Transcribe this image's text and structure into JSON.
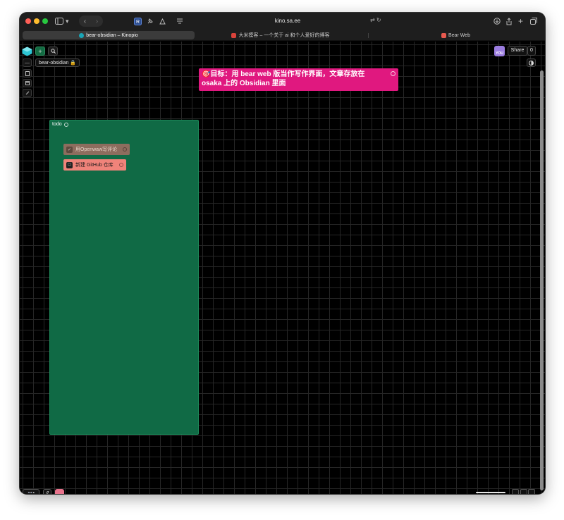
{
  "browser": {
    "url": "kino.sa.ee",
    "tabs": [
      {
        "label": "bear-obsidian – Kinopio",
        "favicon_color": "#1aa6b7",
        "active": true
      },
      {
        "label": "大米摸客 – 一个关于 ai 和个人爱好的博客",
        "favicon_color": "#d9433b",
        "active": false
      },
      {
        "label": "Bear Web",
        "favicon_color": "#e85a4f",
        "active": false
      }
    ]
  },
  "app": {
    "space_name": "bear-obsidian",
    "share_label": "Share",
    "collaborators_count": "0",
    "avatar_label": "YOU"
  },
  "canvas": {
    "goal_card": {
      "text": "🎯目标：用 bear web 版当作写作界面，文章存放在 osaka 上的 Obsidian 里面",
      "color": "#e0187f"
    },
    "box": {
      "label": "todo",
      "color": "#106a45"
    },
    "cards": [
      {
        "text": "用Openwaw写评论",
        "color": "#8d6d5e"
      },
      {
        "text": "新建 GitHub 仓库",
        "color": "#f0837a"
      }
    ]
  }
}
